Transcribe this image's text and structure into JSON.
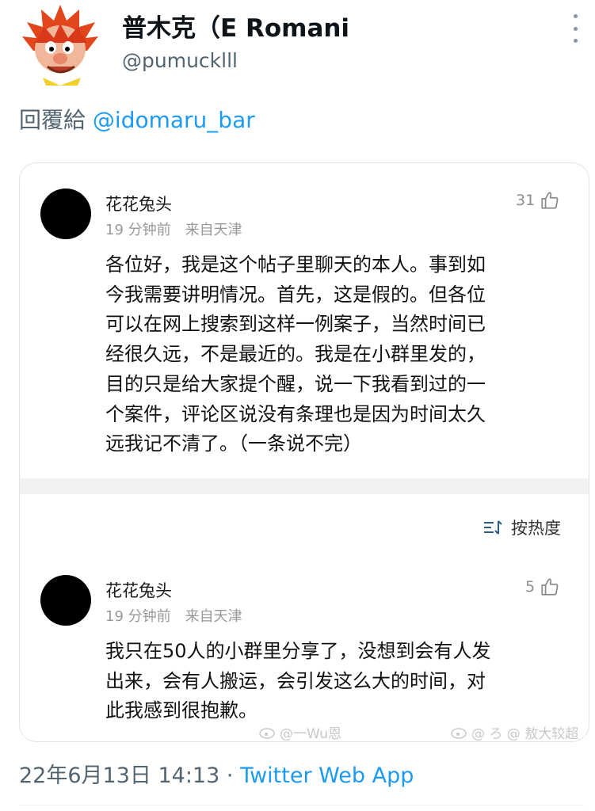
{
  "tweet": {
    "author_name": "普木克（E Romani",
    "author_handle": "@pumucklll",
    "reply_prefix": "回覆給",
    "reply_to": "@idomaru_bar",
    "date": "22年6月13日 14:13",
    "separator": "·",
    "client": "Twitter Web App"
  },
  "comments": [
    {
      "user": "花花兔头",
      "time": "19 分钟前",
      "location": "来自天津",
      "likes": "31",
      "lines": [
        "各位好，我是这个帖子里聊天的本人。事到如",
        "今我需要讲明情况。首先，这是假的。但各位",
        "可以在网上搜索到这样一例案子，当然时间已",
        "经很久远，不是最近的。我是在小群里发的，",
        "目的只是给大家提个醒，说一下我看到过的一",
        "个案件，评论区说没有条理也是因为时间太久",
        "远我记不清了。（一条说不完）"
      ]
    },
    {
      "user": "花花兔头",
      "time": "19 分钟前",
      "location": "来自天津",
      "likes": "5",
      "lines": [
        "我只在50人的小群里分享了，没想到会有人发",
        "出来，会有人搬运，会引发这么大的时间，对",
        "此我感到很抱歉。"
      ]
    }
  ],
  "sort": {
    "label": "按热度"
  },
  "watermarks": [
    "@一Wu恩",
    "@ ろ @ 敖大较超"
  ],
  "colors": {
    "link": "#1d9bf0",
    "secondary": "#536471"
  },
  "icons": [
    "more-dots-icon",
    "thumbs-up-icon",
    "sort-icon",
    "weibo-icon"
  ]
}
